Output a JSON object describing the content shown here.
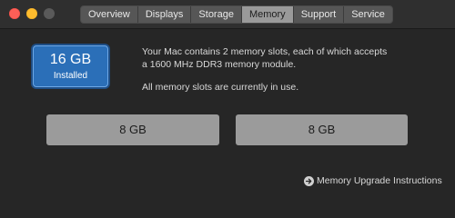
{
  "window": {
    "tabs": [
      "Overview",
      "Displays",
      "Storage",
      "Memory",
      "Support",
      "Service"
    ],
    "active_tab": "Memory"
  },
  "memory": {
    "installed_size": "16 GB",
    "installed_label": "Installed",
    "description_line1": "Your Mac contains 2 memory slots, each of which accepts",
    "description_line2": "a 1600 MHz DDR3 memory module.",
    "slots_status": "All memory slots are currently in use.",
    "slots": [
      "8 GB",
      "8 GB"
    ]
  },
  "footer": {
    "upgrade_link": "Memory Upgrade Instructions"
  }
}
